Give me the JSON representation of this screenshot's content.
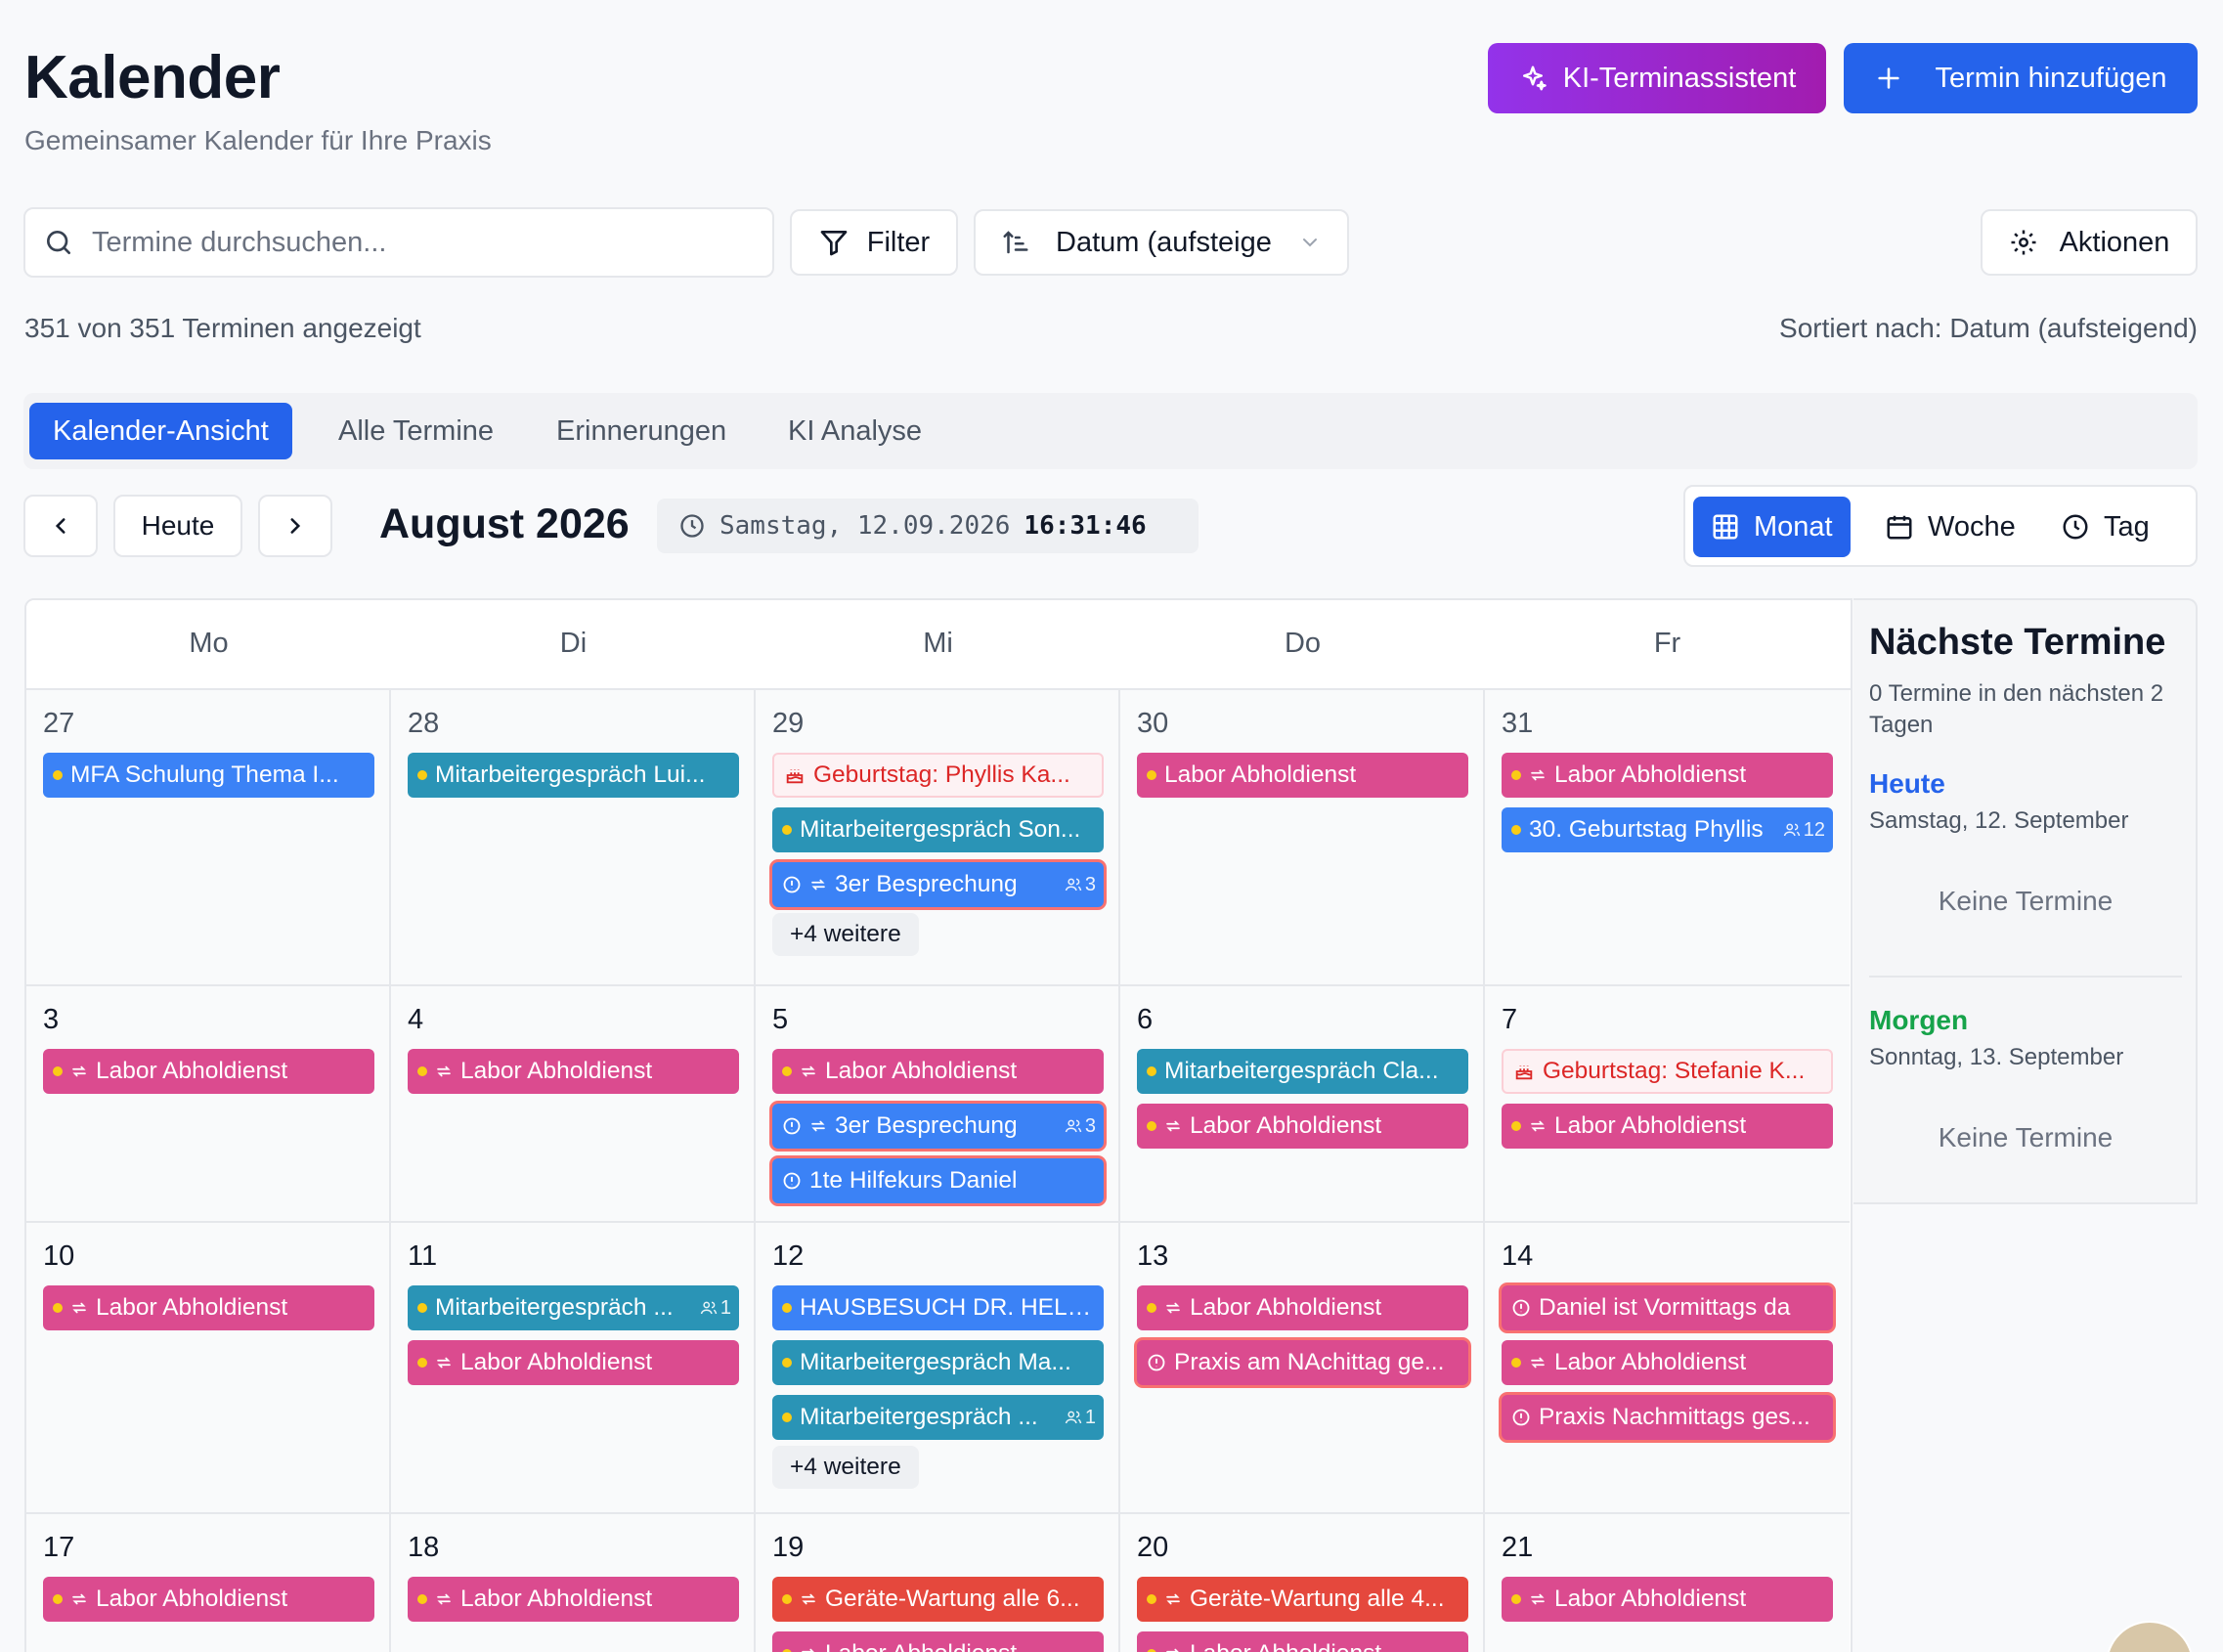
{
  "header": {
    "title": "Kalender",
    "subtitle": "Gemeinsamer Kalender für Ihre Praxis",
    "ai_button": "KI-Terminassistent",
    "add_button": "Termin hinzufügen"
  },
  "toolbar": {
    "search_placeholder": "Termine durchsuchen...",
    "filter_label": "Filter",
    "sort_value": "Datum (aufsteigend)",
    "actions_label": "Aktionen",
    "count_text": "351 von 351 Terminen angezeigt",
    "sorted_text": "Sortiert nach: Datum (aufsteigend)"
  },
  "tabs": [
    "Kalender-Ansicht",
    "Alle Termine",
    "Erinnerungen",
    "KI Analyse"
  ],
  "nav": {
    "today": "Heute",
    "month_title": "August 2026",
    "clock_date": "Samstag, 12.09.2026",
    "clock_time": "16:31:46"
  },
  "views": [
    "Monat",
    "Woche",
    "Tag"
  ],
  "weekdays": [
    "Mo",
    "Di",
    "Mi",
    "Do",
    "Fr"
  ],
  "weeks": [
    {
      "days": [
        {
          "num": "27",
          "prev": true,
          "events": [
            {
              "label": "MFA Schulung Thema I...",
              "color": "blue"
            }
          ]
        },
        {
          "num": "28",
          "prev": true,
          "events": [
            {
              "label": "Mitarbeitergespräch Lui...",
              "color": "teal"
            }
          ]
        },
        {
          "num": "29",
          "prev": true,
          "events": [
            {
              "label": "Geburtstag: Phyllis Ka...",
              "color": "bday",
              "icon": "cake"
            },
            {
              "label": "Mitarbeitergespräch Son...",
              "color": "teal"
            },
            {
              "label": "3er Besprechung",
              "color": "blue",
              "urgent": true,
              "recur": true,
              "people": "3"
            }
          ],
          "more": "+4 weitere"
        },
        {
          "num": "30",
          "prev": true,
          "events": [
            {
              "label": "Labor Abholdienst",
              "color": "pink"
            }
          ]
        },
        {
          "num": "31",
          "prev": true,
          "events": [
            {
              "label": "Labor Abholdienst",
              "color": "pink",
              "recur": true
            },
            {
              "label": "30. Geburtstag Phyllis",
              "color": "blue",
              "people": "12"
            }
          ]
        }
      ]
    },
    {
      "days": [
        {
          "num": "3",
          "events": [
            {
              "label": "Labor Abholdienst",
              "color": "pink",
              "recur": true
            }
          ]
        },
        {
          "num": "4",
          "events": [
            {
              "label": "Labor Abholdienst",
              "color": "pink",
              "recur": true
            }
          ]
        },
        {
          "num": "5",
          "events": [
            {
              "label": "Labor Abholdienst",
              "color": "pink",
              "recur": true
            },
            {
              "label": "3er Besprechung",
              "color": "blue",
              "urgent": true,
              "recur": true,
              "people": "3"
            },
            {
              "label": "1te Hilfekurs Daniel",
              "color": "blue",
              "urgent": true
            }
          ]
        },
        {
          "num": "6",
          "events": [
            {
              "label": "Mitarbeitergespräch Cla...",
              "color": "teal"
            },
            {
              "label": "Labor Abholdienst",
              "color": "pink",
              "recur": true
            }
          ]
        },
        {
          "num": "7",
          "events": [
            {
              "label": "Geburtstag: Stefanie K...",
              "color": "bday",
              "icon": "cake"
            },
            {
              "label": "Labor Abholdienst",
              "color": "pink",
              "recur": true
            }
          ]
        }
      ]
    },
    {
      "days": [
        {
          "num": "10",
          "events": [
            {
              "label": "Labor Abholdienst",
              "color": "pink",
              "recur": true
            }
          ]
        },
        {
          "num": "11",
          "events": [
            {
              "label": "Mitarbeitergespräch ...",
              "color": "teal",
              "people": "1"
            },
            {
              "label": "Labor Abholdienst",
              "color": "pink",
              "recur": true
            }
          ]
        },
        {
          "num": "12",
          "events": [
            {
              "label": "HAUSBESUCH DR. HELB...",
              "color": "blue"
            },
            {
              "label": "Mitarbeitergespräch Ma...",
              "color": "teal"
            },
            {
              "label": "Mitarbeitergespräch ...",
              "color": "teal",
              "people": "1"
            }
          ],
          "more": "+4 weitere"
        },
        {
          "num": "13",
          "events": [
            {
              "label": "Labor Abholdienst",
              "color": "pink",
              "recur": true
            },
            {
              "label": "Praxis am NAchittag ge...",
              "color": "pink",
              "urgent": true
            }
          ]
        },
        {
          "num": "14",
          "events": [
            {
              "label": "Daniel ist Vormittags da",
              "color": "pink",
              "urgent": true
            },
            {
              "label": "Labor Abholdienst",
              "color": "pink",
              "recur": true
            },
            {
              "label": "Praxis Nachmittags ges...",
              "color": "pink",
              "urgent": true
            }
          ]
        }
      ]
    },
    {
      "days": [
        {
          "num": "17",
          "events": [
            {
              "label": "Labor Abholdienst",
              "color": "pink",
              "recur": true
            }
          ]
        },
        {
          "num": "18",
          "events": [
            {
              "label": "Labor Abholdienst",
              "color": "pink",
              "recur": true
            }
          ]
        },
        {
          "num": "19",
          "events": [
            {
              "label": "Geräte-Wartung alle 6...",
              "color": "red",
              "recur": true
            },
            {
              "label": "Labor Abholdienst",
              "color": "pink",
              "recur": true
            }
          ]
        },
        {
          "num": "20",
          "events": [
            {
              "label": "Geräte-Wartung alle 4...",
              "color": "red",
              "recur": true
            },
            {
              "label": "Labor Abholdienst",
              "color": "pink",
              "recur": true
            }
          ]
        },
        {
          "num": "21",
          "events": [
            {
              "label": "Labor Abholdienst",
              "color": "pink",
              "recur": true
            }
          ]
        }
      ]
    }
  ],
  "sidebar": {
    "title": "Nächste Termine",
    "subtitle": "0 Termine in den nächsten 2 Tagen",
    "today_title": "Heute",
    "today_date": "Samstag, 12. September",
    "today_empty": "Keine Termine",
    "tomorrow_title": "Morgen",
    "tomorrow_date": "Sonntag, 13. September",
    "tomorrow_empty": "Keine Termine"
  },
  "colors": {
    "primary": "#2563eb",
    "ai": "#9333ea",
    "today": "#2563eb",
    "tomorrow": "#16a34a"
  }
}
